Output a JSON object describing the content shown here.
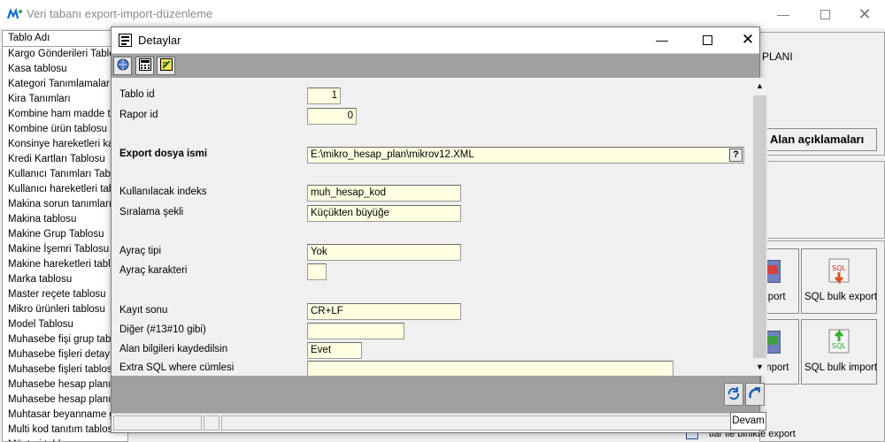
{
  "main_window": {
    "title": "Veri tabanı export-import-düzenleme",
    "table_header": "Tablo Adı",
    "tables": [
      "Kargo Gönderileri Tablosu",
      "Kasa tablosu",
      "Kategori Tanımlamaları Tablosu",
      "Kira Tanımları",
      "Kombine ham madde tablosu",
      "Kombine ürün tablosu",
      "Konsinye hareketleri kayıtları",
      "Kredi Kartları Tablosu",
      "Kullanıcı Tanımları Tablosu",
      "Kullanıcı hareketleri tablosu",
      "Makina sorun tanımları tablosu",
      "Makina tablosu",
      "Makine Grup Tablosu",
      "Makine İşemri Tablosu",
      "Makine hareketleri tablosu",
      "Marka tablosu",
      "Master reçete tablosu",
      "Mikro ürünleri tablosu",
      "Model Tablosu",
      "Muhasebe fişi grup tablosu",
      "Muhasebe fişleri detay tablosu",
      "Muhasebe fişleri tablosu",
      "Muhasebe hesap planı grupları",
      "Muhasebe hesap planı tablosu",
      "Muhtasar beyanname grupları",
      "Multi kod tanıtım tablosu",
      "Müşteri tablosu"
    ],
    "right_top_text": "PLANI",
    "alan_aciklamalari": "Alan açıklamaları",
    "sql_bulk_export": "SQL bulk export",
    "sql_bulk_import": "SQL bulk import",
    "export_partial": "xport",
    "import_partial": "mport",
    "bottom_partial": "tlar ile birlikte export"
  },
  "dialog": {
    "title": "Detaylar",
    "fields": {
      "tablo_id": {
        "label": "Tablo id",
        "value": "1"
      },
      "rapor_id": {
        "label": "Rapor id",
        "value": "0"
      },
      "export_dosya": {
        "label": "Export dosya ismi",
        "value": "E:\\mikro_hesap_plan\\mikrov12.XML"
      },
      "indeks": {
        "label": "Kullanılacak indeks",
        "value": "muh_hesap_kod"
      },
      "siralama": {
        "label": "Sıralama şekli",
        "value": "Küçükten büyüğe"
      },
      "ayrac_tipi": {
        "label": "Ayraç tipi",
        "value": "Yok"
      },
      "ayrac_karakter": {
        "label": "Ayraç karakteri",
        "value": ""
      },
      "kayit_sonu": {
        "label": "Kayıt sonu",
        "value": "CR+LF"
      },
      "diger": {
        "label": "Diğer (#13#10 gibi)",
        "value": ""
      },
      "alan_bilgileri": {
        "label": "Alan bilgileri kaydedilsin",
        "value": "Evet"
      },
      "extra_sql": {
        "label": "Extra SQL where cümlesi",
        "value": ""
      }
    },
    "browse_label": "?",
    "tooltip": "Devam"
  },
  "colors": {
    "field_bg": "#ffffe1",
    "toolbar_bg": "#a0a0a0",
    "window_bg": "#f0f0f0"
  }
}
